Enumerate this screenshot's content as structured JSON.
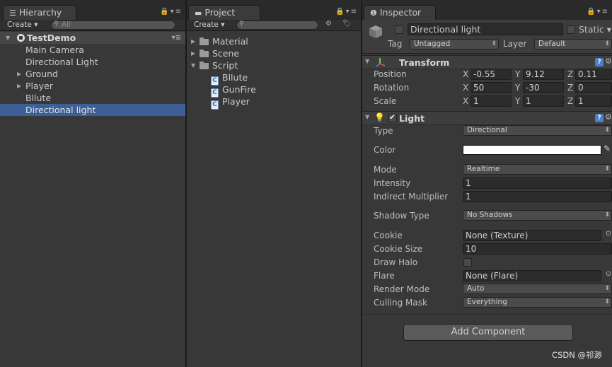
{
  "hierarchy": {
    "tab": "Hierarchy",
    "create": "Create ▾",
    "search_placeholder": "All",
    "scene": "TestDemo",
    "items": [
      {
        "label": "Main Camera"
      },
      {
        "label": "Directional Light"
      },
      {
        "label": "Ground"
      },
      {
        "label": "Player"
      },
      {
        "label": "Bllute"
      },
      {
        "label": "Directional light"
      }
    ]
  },
  "project": {
    "tab": "Project",
    "create": "Create ▾",
    "items": [
      {
        "label": "Material"
      },
      {
        "label": "Scene"
      },
      {
        "label": "Script"
      },
      {
        "label": "Bllute"
      },
      {
        "label": "GunFire"
      },
      {
        "label": "Player"
      }
    ]
  },
  "inspector": {
    "tab": "Inspector",
    "object_name": "Directional light",
    "static_label": "Static ▾",
    "tag_label": "Tag",
    "tag_value": "Untagged",
    "layer_label": "Layer",
    "layer_value": "Default",
    "transform": {
      "title": "Transform",
      "position_label": "Position",
      "rotation_label": "Rotation",
      "scale_label": "Scale",
      "position": {
        "x": "-0.55",
        "y": "9.12",
        "z": "0.11"
      },
      "rotation": {
        "x": "50",
        "y": "-30",
        "z": "0"
      },
      "scale": {
        "x": "1",
        "y": "1",
        "z": "1"
      }
    },
    "light": {
      "title": "Light",
      "type_label": "Type",
      "type_value": "Directional",
      "color_label": "Color",
      "color_value": "#ffffff",
      "mode_label": "Mode",
      "mode_value": "Realtime",
      "intensity_label": "Intensity",
      "intensity_value": "1",
      "indirect_label": "Indirect Multiplier",
      "indirect_value": "1",
      "shadow_label": "Shadow Type",
      "shadow_value": "No Shadows",
      "cookie_label": "Cookie",
      "cookie_value": "None (Texture)",
      "cookie_size_label": "Cookie Size",
      "cookie_size_value": "10",
      "draw_halo_label": "Draw Halo",
      "flare_label": "Flare",
      "flare_value": "None (Flare)",
      "render_mode_label": "Render Mode",
      "render_mode_value": "Auto",
      "culling_label": "Culling Mask",
      "culling_value": "Everything"
    },
    "add_component": "Add Component"
  },
  "watermark": "CSDN @祁渺"
}
